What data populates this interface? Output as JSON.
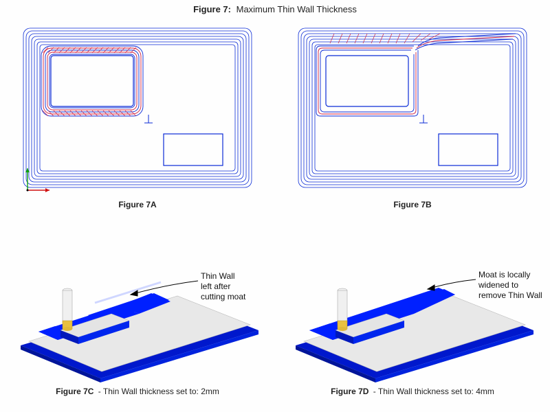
{
  "title_bold": "Figure 7:",
  "title_text": "Maximum Thin Wall Thickness",
  "topA": {
    "label": "Figure 7A"
  },
  "topB": {
    "label": "Figure 7B"
  },
  "botC": {
    "label_bold": "Figure 7C",
    "label_rest": " - Thin Wall thickness set to: 2mm",
    "anno": "Thin Wall\nleft after\ncutting moat"
  },
  "botD": {
    "label_bold": "Figure 7D",
    "label_rest": " - Thin Wall thickness set to: 4mm",
    "anno": "Moat is locally\nwidened to\nremove Thin Wall"
  },
  "colors": {
    "toolpath": "#0a2bd6",
    "toolpath2": "#d02040",
    "part_fill": "#e8e8e8",
    "moat": "#0020ff",
    "floor": "#0018cc",
    "axis_x": "#d01010",
    "axis_y": "#10a010",
    "tool_body": "#f0f0f0",
    "tool_tip": "#e8c040"
  }
}
